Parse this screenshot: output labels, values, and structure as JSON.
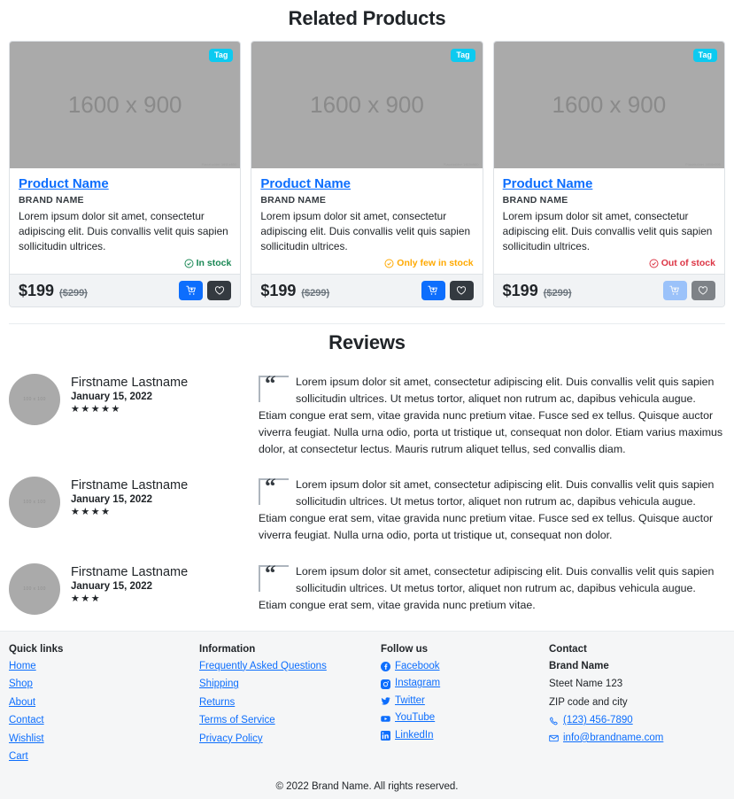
{
  "sections": {
    "related_title": "Related Products",
    "reviews_title": "Reviews"
  },
  "colors": {
    "accent": "#0d6efd",
    "tag": "#0dcaf0",
    "in_stock": "#198754",
    "few_stock": "#ffa900",
    "out_stock": "#dc3545",
    "dark": "#343a40",
    "placeholder": "#aaaaaa"
  },
  "products": [
    {
      "tag": "Tag",
      "image_placeholder": "1600 x 900",
      "image_credit": "Placeholder 1600x900",
      "name": "Product Name",
      "brand": "BRAND NAME",
      "description": "Lorem ipsum dolor sit amet, consectetur adipiscing elit. Duis convallis velit quis sapien sollicitudin ultrices.",
      "stock_label": "In stock",
      "stock_state": "in",
      "price": "$199",
      "price_old": "($299)",
      "cart_label": "add-to-cart",
      "wish_label": "add-to-wishlist",
      "disabled": false
    },
    {
      "tag": "Tag",
      "image_placeholder": "1600 x 900",
      "image_credit": "Placeholder 1600x900",
      "name": "Product Name",
      "brand": "BRAND NAME",
      "description": "Lorem ipsum dolor sit amet, consectetur adipiscing elit. Duis convallis velit quis sapien sollicitudin ultrices.",
      "stock_label": "Only few in stock",
      "stock_state": "few",
      "price": "$199",
      "price_old": "($299)",
      "cart_label": "add-to-cart",
      "wish_label": "add-to-wishlist",
      "disabled": false
    },
    {
      "tag": "Tag",
      "image_placeholder": "1600 x 900",
      "image_credit": "Placeholder 1600x900",
      "name": "Product Name",
      "brand": "BRAND NAME",
      "description": "Lorem ipsum dolor sit amet, consectetur adipiscing elit. Duis convallis velit quis sapien sollicitudin ultrices.",
      "stock_label": "Out of stock",
      "stock_state": "out",
      "price": "$199",
      "price_old": "($299)",
      "cart_label": "add-to-cart",
      "wish_label": "add-to-wishlist",
      "disabled": true
    }
  ],
  "reviews": [
    {
      "avatar_placeholder": "100 x 100",
      "name": "Firstname Lastname",
      "date": "January 15, 2022",
      "rating": 5,
      "stars": "★★★★★",
      "text": "Lorem ipsum dolor sit amet, consectetur adipiscing elit. Duis convallis velit quis sapien sollicitudin ultrices. Ut metus tortor, aliquet non rutrum ac, dapibus vehicula augue. Etiam congue erat sem, vitae gravida nunc pretium vitae. Fusce sed ex tellus. Quisque auctor viverra feugiat. Nulla urna odio, porta ut tristique ut, consequat non dolor. Etiam varius maximus dolor, at consectetur lectus. Mauris rutrum aliquet tellus, sed convallis diam."
    },
    {
      "avatar_placeholder": "100 x 100",
      "name": "Firstname Lastname",
      "date": "January 15, 2022",
      "rating": 4,
      "stars": "★★★★",
      "text": "Lorem ipsum dolor sit amet, consectetur adipiscing elit. Duis convallis velit quis sapien sollicitudin ultrices. Ut metus tortor, aliquet non rutrum ac, dapibus vehicula augue. Etiam congue erat sem, vitae gravida nunc pretium vitae. Fusce sed ex tellus. Quisque auctor viverra feugiat. Nulla urna odio, porta ut tristique ut, consequat non dolor."
    },
    {
      "avatar_placeholder": "100 x 100",
      "name": "Firstname Lastname",
      "date": "January 15, 2022",
      "rating": 3,
      "stars": "★★★",
      "text": "Lorem ipsum dolor sit amet, consectetur adipiscing elit. Duis convallis velit quis sapien sollicitudin ultrices. Ut metus tortor, aliquet non rutrum ac, dapibus vehicula augue. Etiam congue erat sem, vitae gravida nunc pretium vitae."
    }
  ],
  "footer": {
    "quick_links": {
      "heading": "Quick links",
      "items": [
        "Home",
        "Shop",
        "About",
        "Contact",
        "Wishlist",
        "Cart"
      ]
    },
    "information": {
      "heading": "Information",
      "items": [
        "Frequently Asked Questions",
        "Shipping",
        "Returns",
        "Terms of Service",
        "Privacy Policy"
      ]
    },
    "follow_us": {
      "heading": "Follow us",
      "items": [
        {
          "label": "Facebook",
          "icon": "facebook-icon"
        },
        {
          "label": "Instagram",
          "icon": "instagram-icon"
        },
        {
          "label": "Twitter",
          "icon": "twitter-icon"
        },
        {
          "label": "YouTube",
          "icon": "youtube-icon"
        },
        {
          "label": "LinkedIn",
          "icon": "linkedin-icon"
        }
      ]
    },
    "contact": {
      "heading": "Contact",
      "brand": "Brand Name",
      "street": "Steet Name 123",
      "city": "ZIP code and city",
      "phone": "(123) 456-7890",
      "email": "info@brandname.com"
    },
    "copyright": "© 2022 Brand Name. All rights reserved."
  }
}
